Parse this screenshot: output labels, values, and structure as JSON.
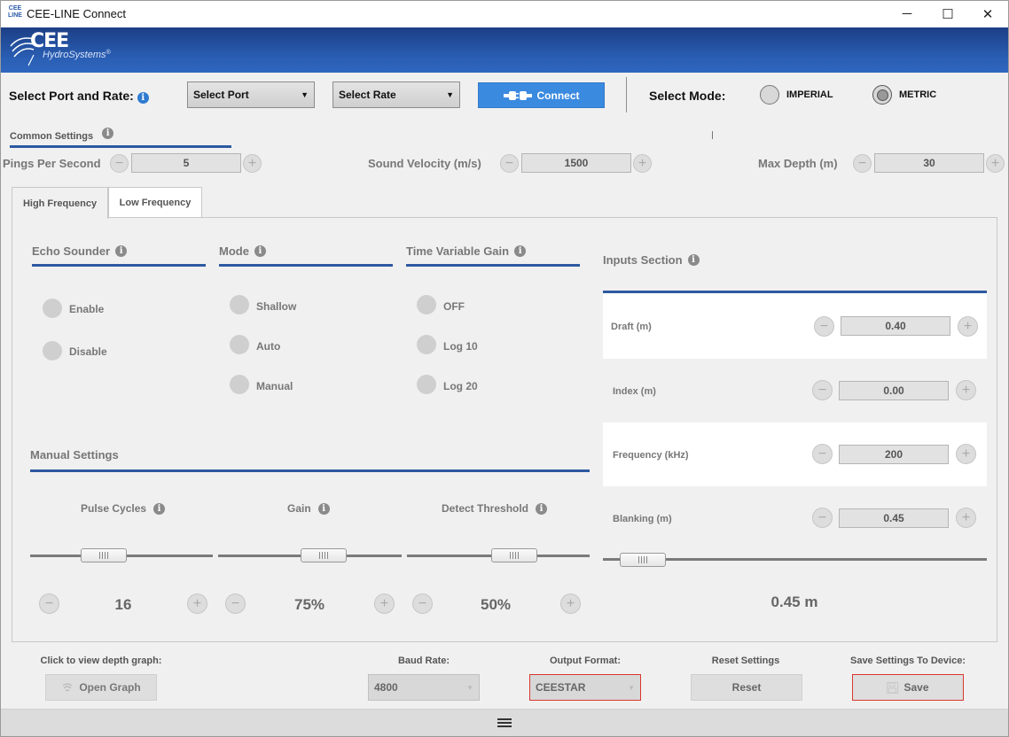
{
  "window": {
    "title": "CEE-LINE Connect",
    "logo_top": "CEE",
    "logo_bottom": "LINE",
    "minimize": "─",
    "maximize": "☐",
    "close": "✕"
  },
  "brand": {
    "name": "CEE",
    "sub": "HydroSystems",
    "mark": "®"
  },
  "connection": {
    "label": "Select Port and Rate:",
    "port_select": "Select Port",
    "rate_select": "Select Rate",
    "connect_label": "Connect",
    "mode_label": "Select Mode:",
    "imperial_label": "IMPERIAL",
    "metric_label": "METRIC",
    "selected_mode": "METRIC"
  },
  "common": {
    "title": "Common Settings",
    "pings_label": "Pings Per Second",
    "pings_value": "5",
    "velocity_label": "Sound Velocity (m/s)",
    "velocity_value": "1500",
    "depth_label": "Max Depth (m)",
    "depth_value": "30"
  },
  "tabs": [
    {
      "label": "High Frequency",
      "active": true
    },
    {
      "label": "Low Frequency",
      "active": false
    }
  ],
  "echo": {
    "title": "Echo Sounder",
    "options": [
      "Enable",
      "Disable"
    ]
  },
  "mode": {
    "title": "Mode",
    "options": [
      "Shallow",
      "Auto",
      "Manual"
    ]
  },
  "tvg": {
    "title": "Time Variable Gain",
    "options": [
      "OFF",
      "Log 10",
      "Log 20"
    ]
  },
  "manual": {
    "title": "Manual Settings",
    "pulse": {
      "label": "Pulse Cycles",
      "value": "16",
      "fraction": 0.37
    },
    "gain": {
      "label": "Gain",
      "value": "75%",
      "fraction": 0.6
    },
    "threshold": {
      "label": "Detect Threshold",
      "value": "50%",
      "fraction": 0.62
    }
  },
  "inputs": {
    "title": "Inputs Section",
    "draft_label": "Draft (m)",
    "draft_value": "0.40",
    "index_label": "Index (m)",
    "index_value": "0.00",
    "freq_label": "Frequency (kHz)",
    "freq_value": "200",
    "blank_label": "Blanking (m)",
    "blank_value": "0.45",
    "blank_display": "0.45 m",
    "blank_fraction": 0.05
  },
  "footer": {
    "graph_label": "Click to view depth graph:",
    "graph_button": "Open Graph",
    "baud_label": "Baud Rate:",
    "baud_value": "4800",
    "format_label": "Output Format:",
    "format_value": "CEESTAR",
    "reset_label": "Reset Settings",
    "reset_button": "Reset",
    "save_label": "Save Settings To Device:",
    "save_button": "Save"
  },
  "colors": {
    "accent": "#3a8ae0",
    "banner": "#2a5fb5",
    "underline": "#2d5aa0",
    "alert": "#d9372f"
  }
}
